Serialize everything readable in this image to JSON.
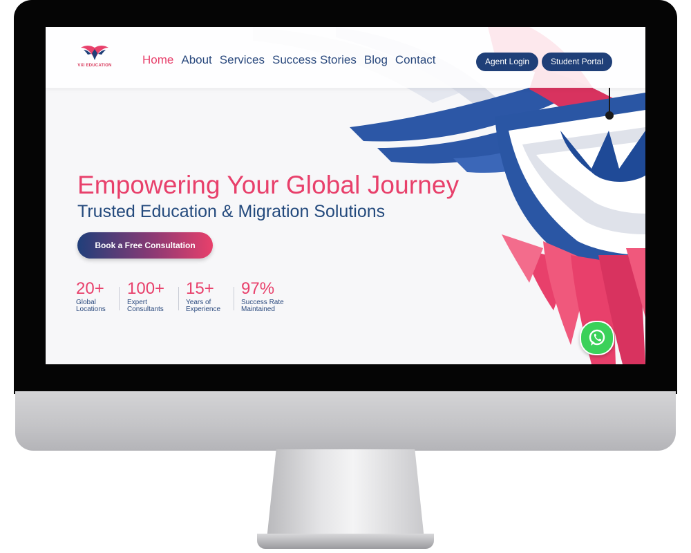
{
  "brand": {
    "logo_text": "VXI EDUCATION",
    "colors": {
      "primary_pink": "#e8406b",
      "primary_navy": "#1f3f78"
    }
  },
  "nav": {
    "items": [
      {
        "label": "Home",
        "active": true
      },
      {
        "label": "About",
        "active": false
      },
      {
        "label": "Services",
        "active": false
      },
      {
        "label": "Success Stories",
        "active": false
      },
      {
        "label": "Blog",
        "active": false
      },
      {
        "label": "Contact",
        "active": false
      }
    ],
    "agent_login": "Agent Login",
    "student_portal": "Student Portal"
  },
  "hero": {
    "title": "Empowering Your Global Journey",
    "subtitle": "Trusted Education & Migration Solutions",
    "cta": "Book a Free Consultation"
  },
  "stats": [
    {
      "value": "20+",
      "label": "Global Locations"
    },
    {
      "value": "100+",
      "label": "Expert Consultants"
    },
    {
      "value": "15+",
      "label": "Years of Experience"
    },
    {
      "value": "97%",
      "label": "Success Rate Maintained"
    }
  ],
  "icons": {
    "logo": "eagle-logo-icon",
    "floating": "whatsapp-icon"
  }
}
